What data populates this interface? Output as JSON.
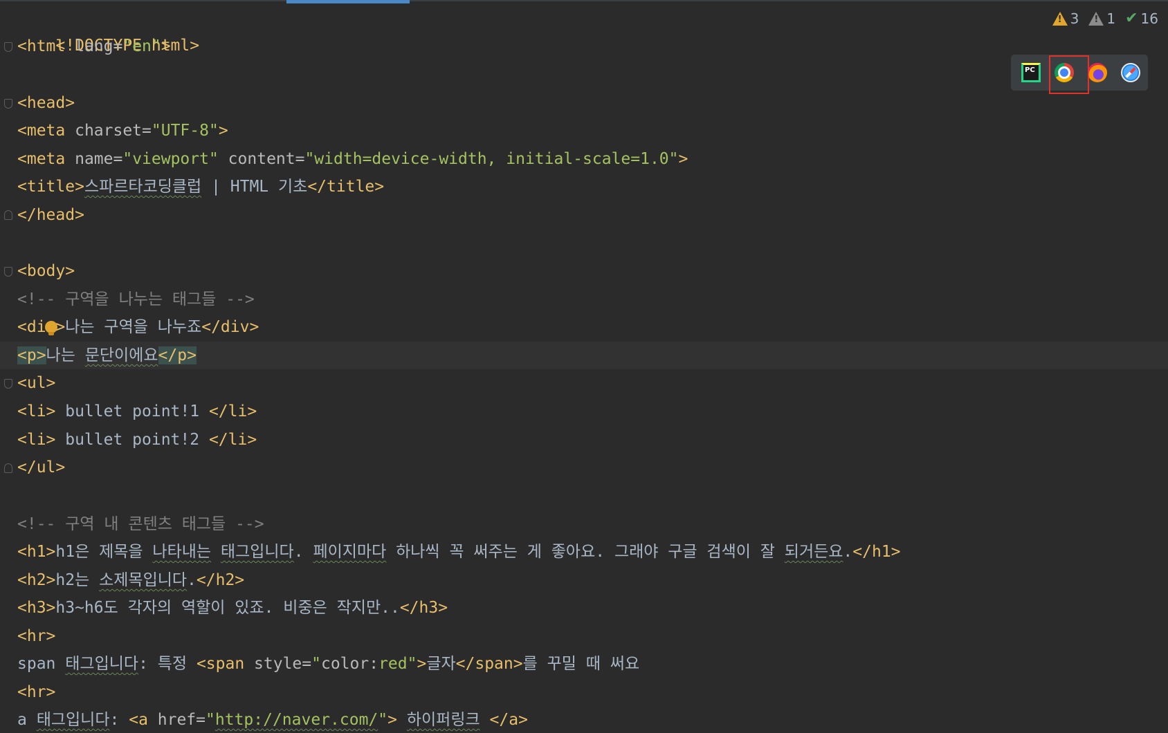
{
  "inspections": {
    "warnings": "3",
    "weak_warnings": "1",
    "typos": "16"
  },
  "browsers": [
    {
      "name": "pycharm",
      "icon": "pycharm-icon"
    },
    {
      "name": "chrome",
      "icon": "chrome-icon",
      "selected": true
    },
    {
      "name": "firefox",
      "icon": "firefox-icon"
    },
    {
      "name": "safari",
      "icon": "safari-icon"
    }
  ],
  "code": {
    "l1": "<!DOCTYPE html>",
    "l2_tag_open": "<html ",
    "l2_attr": "lang=",
    "l2_val": "\"en\"",
    "l2_close": ">",
    "l4": "<head>",
    "l5_tag": "<meta ",
    "l5_attr": "charset=",
    "l5_val": "\"UTF-8\"",
    "l5_close": ">",
    "l6_tag": "<meta ",
    "l6_attr1": "name=",
    "l6_val1": "\"viewport\"",
    "l6_attr2": " content=",
    "l6_val2": "\"width=device-width, initial-scale=1.0\"",
    "l6_close": ">",
    "l7_open": "<title>",
    "l7_text_sq": "스파르타코딩클럽",
    "l7_text": " | HTML 기초",
    "l7_close": "</title>",
    "l8": "</head>",
    "l10": "<body>",
    "l11": "<!-- 구역을 나누는 태그들 -->",
    "l12_open": "<div>",
    "l12_text": "나는 구역을 나누죠",
    "l12_close": "</div>",
    "l13_open": "<p>",
    "l13_text1": "나는 ",
    "l13_text_sq": "문단이에요",
    "l13_close": "</p>",
    "l14": "<ul>",
    "l15_open": "<li>",
    "l15_text": " bullet point!1 ",
    "l15_close": "</li>",
    "l16_open": "<li>",
    "l16_text": " bullet point!2 ",
    "l16_close": "</li>",
    "l17": "</ul>",
    "l19": "<!-- 구역 내 콘텐츠 태그들 -->",
    "l20_open": "<h1>",
    "l20_t1": "h1은 제목을 ",
    "l20_sq1": "나타내는",
    "l20_t2": " ",
    "l20_sq2": "태그입니다",
    "l20_t3": ". ",
    "l20_sq3": "페이지마다",
    "l20_t4": " 하나씩 꼭 써주는 게 좋아요. 그래야 구글 검색이 잘 ",
    "l20_sq4": "되거든요",
    "l20_t5": ".",
    "l20_close": "</h1>",
    "l21_open": "<h2>",
    "l21_t1": "h2는 ",
    "l21_sq": "소제목입니다",
    "l21_t2": ".",
    "l21_close": "</h2>",
    "l22_open": "<h3>",
    "l22_text": "h3~h6도 각자의 역할이 있죠. 비중은 작지만..",
    "l22_close": "</h3>",
    "l23": "<hr>",
    "l24_t1": "span ",
    "l24_sq": "태그입니다",
    "l24_t2": ": 특정 ",
    "l24_tag": "<span ",
    "l24_attr": "style=",
    "l24_q1": "\"",
    "l24_prop": "color:",
    "l24_cval": "red",
    "l24_q2": "\"",
    "l24_gt": ">",
    "l24_text": "글자",
    "l24_close": "</span>",
    "l24_t3": "를 꾸밀 때 써요",
    "l25": "<hr>",
    "l26_t1": "a ",
    "l26_sq": "태그입니다",
    "l26_t2": ": ",
    "l26_tag": "<a ",
    "l26_attr": "href=",
    "l26_q1": "\"",
    "l26_url_sq": "http://naver.com/",
    "l26_q2": "\"",
    "l26_gt": ">",
    "l26_t3": " ",
    "l26_text_sq": "하이퍼링크",
    "l26_t4": " ",
    "l26_close": "</a>"
  }
}
